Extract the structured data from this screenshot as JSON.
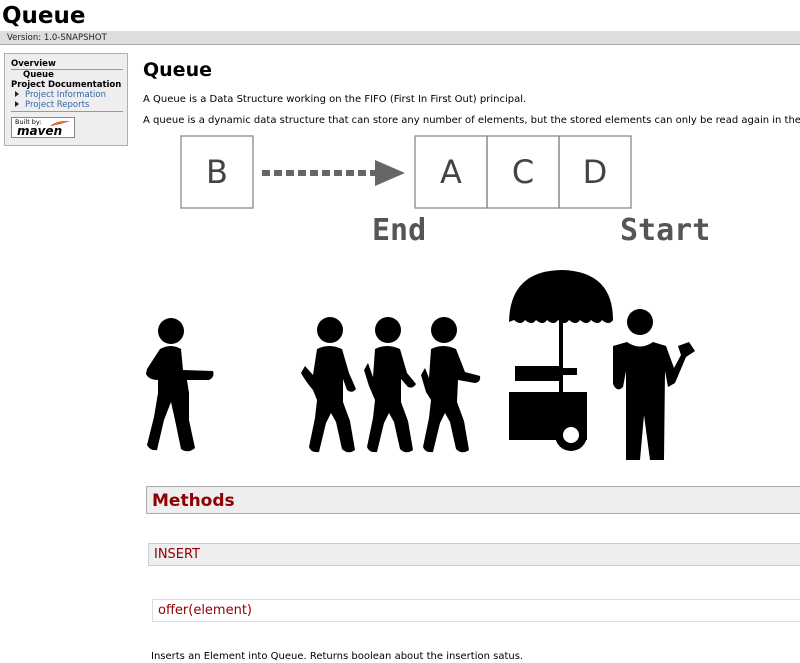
{
  "banner": {
    "title": "Queue"
  },
  "breadcrumbs": {
    "version": "Version: 1.0-SNAPSHOT"
  },
  "nav": {
    "overview": "Overview",
    "current": "Queue",
    "project_docs": "Project Documentation",
    "links": [
      "Project Information",
      "Project Reports"
    ],
    "badge_built_by": "Built by:",
    "badge_brand": "maven"
  },
  "content": {
    "title": "Queue",
    "intro": "A Queue is a Data Structure working on the FIFO (First In First Out) principal.",
    "description": "A queue is a dynamic data structure that can store any number of elements, but the stored elements can only be read again in the same",
    "diagram": {
      "incoming": "B",
      "queue": [
        "A",
        "C",
        "D"
      ],
      "end_label": "End",
      "start_label": "Start"
    },
    "methods_heading": "Methods",
    "insert_heading": "INSERT",
    "offer_signature": "offer(element)",
    "insert_desc": "Inserts an Element into Queue. Returns boolean about the insertion satus."
  }
}
